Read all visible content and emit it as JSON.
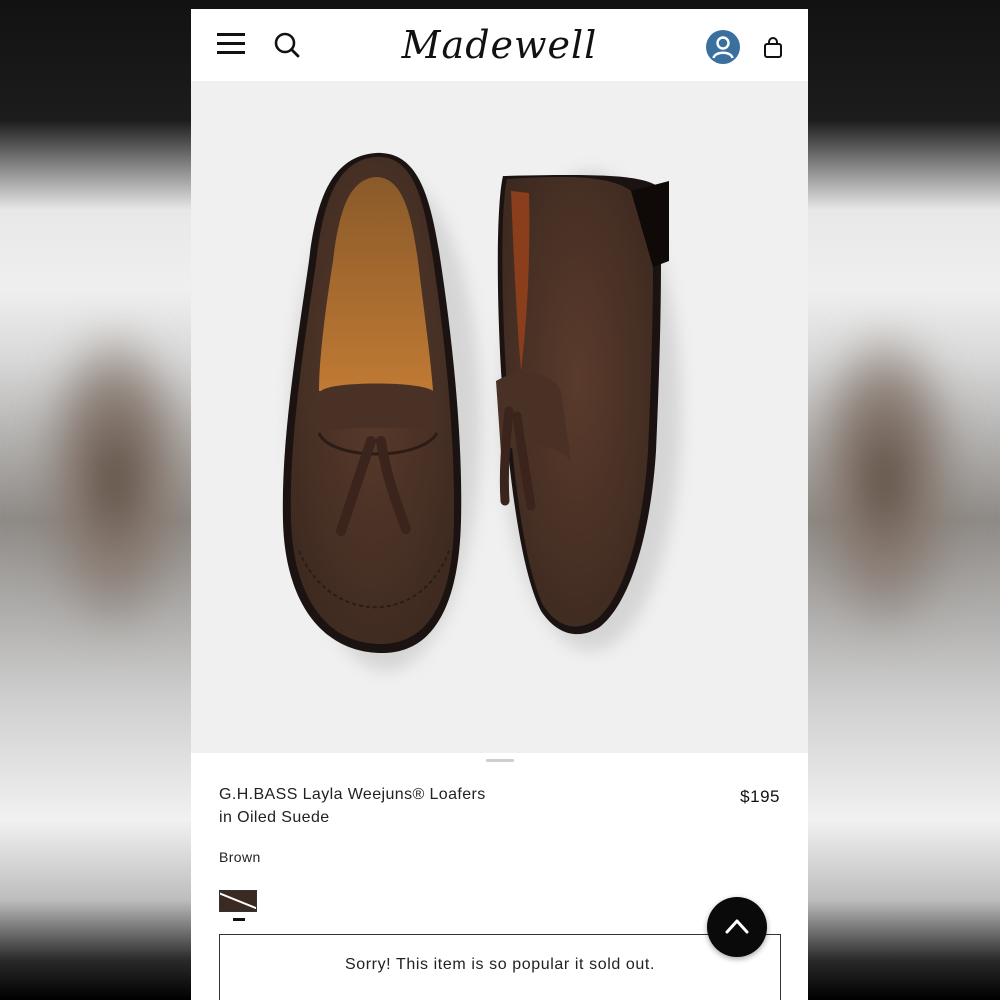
{
  "header": {
    "logo_text": "Madewell",
    "menu_icon": "hamburger-menu-icon",
    "search_icon": "search-icon",
    "account_icon": "account-icon",
    "bag_icon": "shopping-bag-icon",
    "account_color": "#3b6f9e"
  },
  "product": {
    "image_alt_name": "loafers-product-image",
    "title_line1": "G.H.BASS Layla Weejuns® Loafers",
    "title_line2": "in Oiled Suede",
    "price": "$195",
    "color_label": "Brown",
    "swatch_color": "#3a2a22",
    "sold_out_message": "Sorry! This item is so popular it sold out."
  },
  "scroll_top": {
    "icon": "chevron-up-icon"
  }
}
